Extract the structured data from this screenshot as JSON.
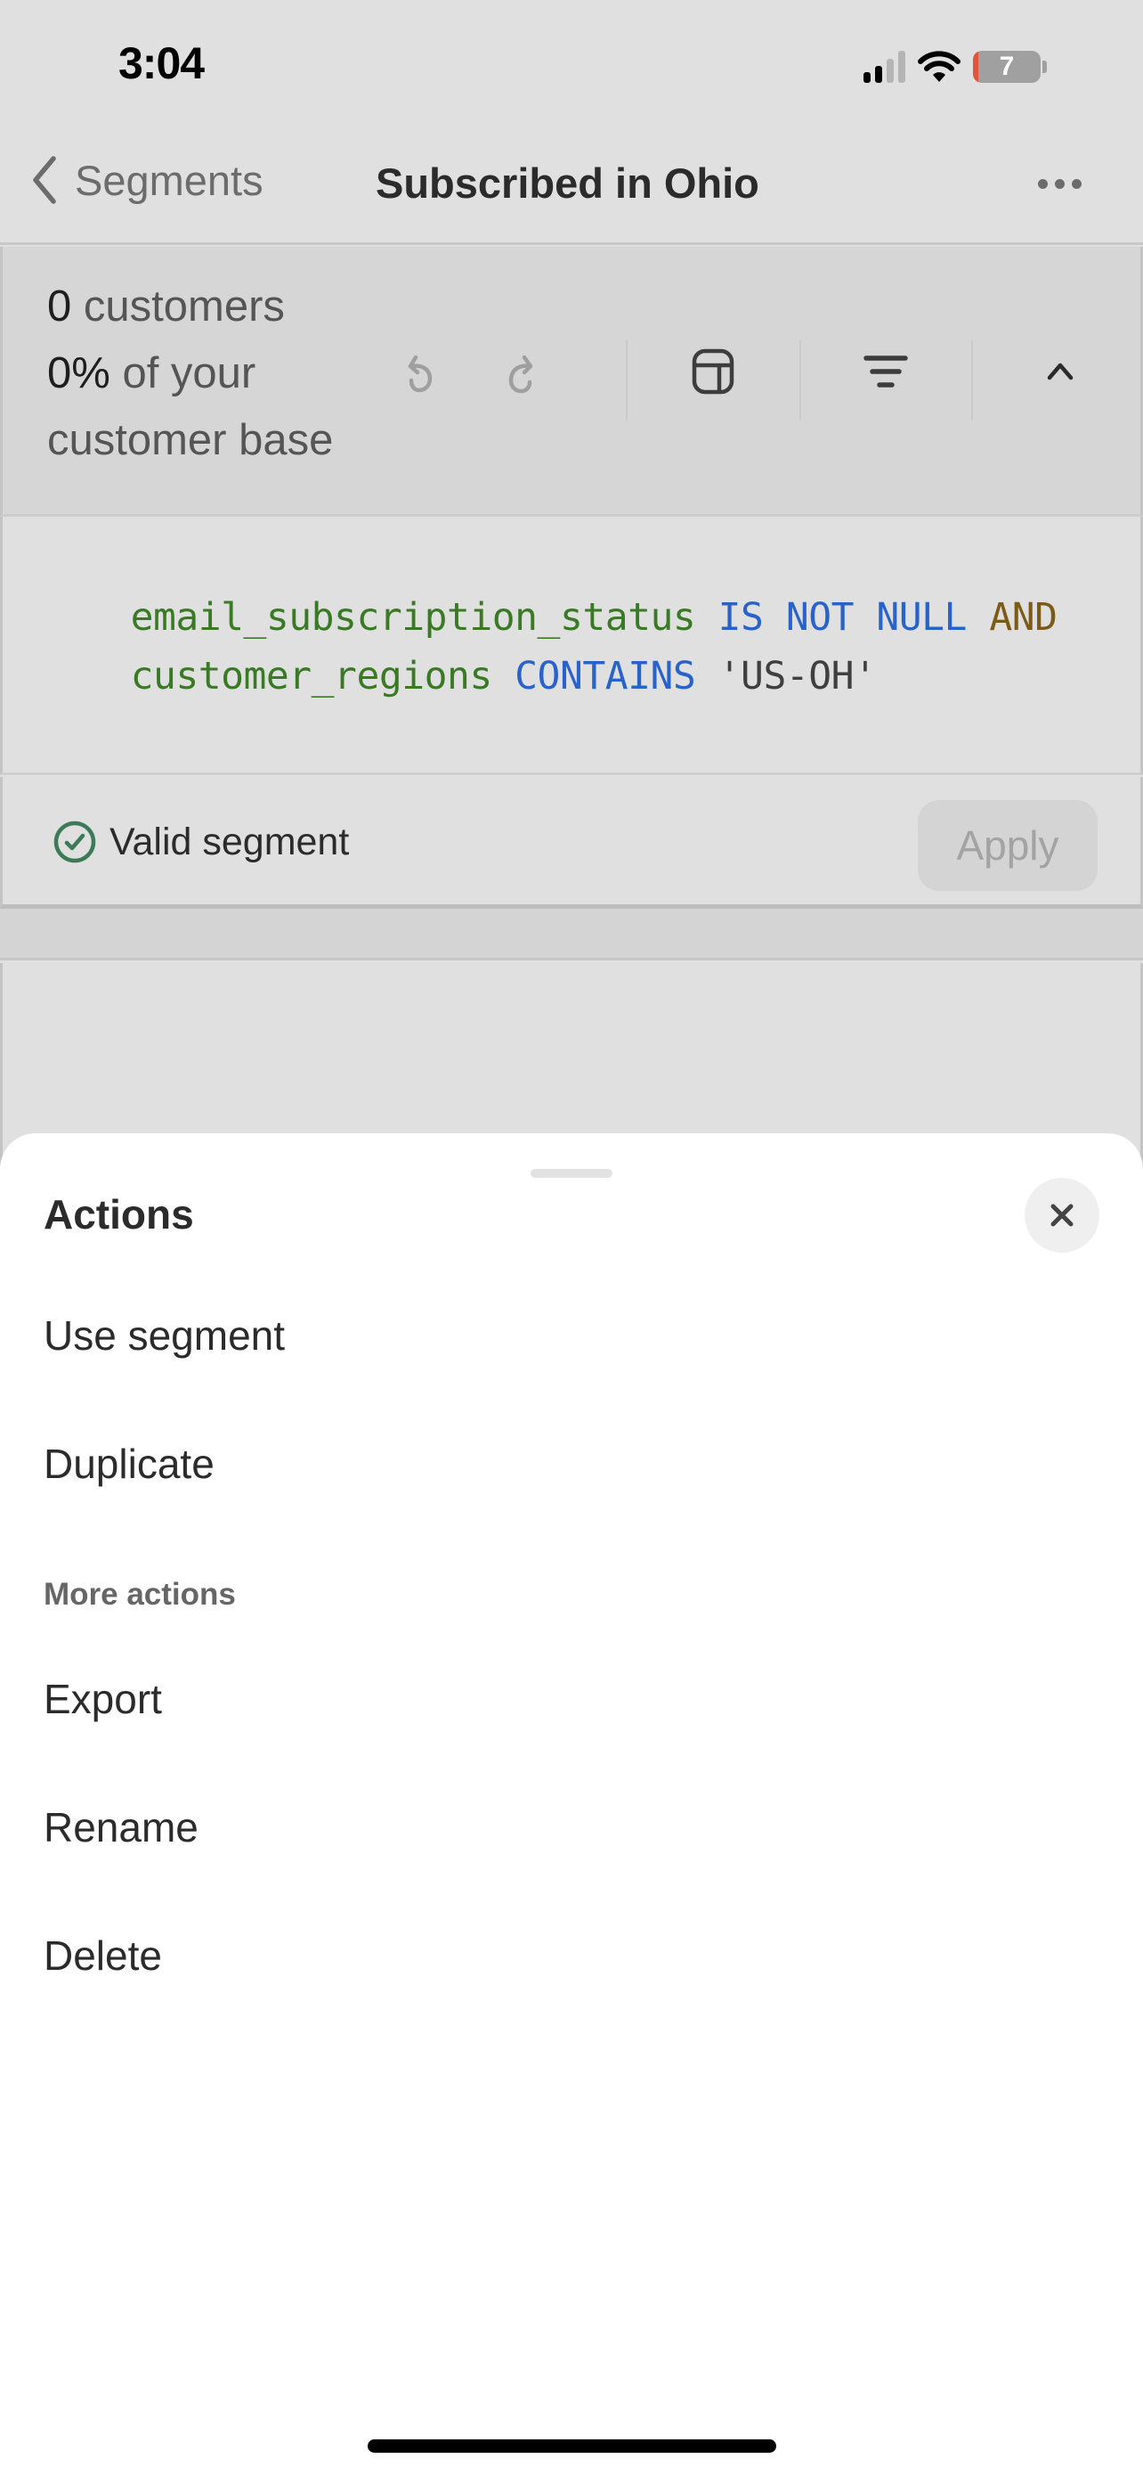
{
  "status_bar": {
    "time": "3:04",
    "signal_bars_active": 2,
    "signal_bars_total": 4,
    "battery_level": "7",
    "icons": [
      "cellular-signal-icon",
      "wifi-icon",
      "battery-icon"
    ]
  },
  "nav": {
    "back_label": "Segments",
    "title": "Subscribed in Ohio",
    "more_icon": "more-horizontal-icon"
  },
  "stats": {
    "count_number": "0",
    "count_label": " customers",
    "percent_number": "0%",
    "percent_label": " of your",
    "percent_label_2": "customer base"
  },
  "toolbar": {
    "items": [
      {
        "icon": "undo-icon",
        "enabled": false
      },
      {
        "icon": "redo-icon",
        "enabled": false
      },
      {
        "icon": "table-layout-icon",
        "enabled": true
      },
      {
        "icon": "filter-icon",
        "enabled": true
      },
      {
        "icon": "chevron-up-icon",
        "enabled": true
      }
    ]
  },
  "query": {
    "line1": [
      {
        "text": "email_subscription_status",
        "type": "field"
      },
      {
        "text": " ",
        "type": "space"
      },
      {
        "text": "IS NOT NULL",
        "type": "keyword"
      },
      {
        "text": " ",
        "type": "space"
      },
      {
        "text": "AND",
        "type": "operator"
      }
    ],
    "line2": [
      {
        "text": "customer_regions",
        "type": "field"
      },
      {
        "text": " ",
        "type": "space"
      },
      {
        "text": "CONTAINS",
        "type": "keyword"
      },
      {
        "text": " ",
        "type": "space"
      },
      {
        "text": "'US-OH'",
        "type": "string"
      }
    ],
    "colors": {
      "field": "#3a7a25",
      "keyword": "#2962c9",
      "operator": "#7c5a18",
      "string": "#3f3f3f"
    }
  },
  "validation": {
    "status_text": "Valid segment",
    "status_color": "#3d7a57",
    "apply_label": "Apply",
    "apply_enabled": false
  },
  "sheet": {
    "title": "Actions",
    "close_icon": "close-icon",
    "primary_actions": [
      {
        "label": "Use segment"
      },
      {
        "label": "Duplicate"
      }
    ],
    "section_label": "More actions",
    "more_actions": [
      {
        "label": "Export"
      },
      {
        "label": "Rename"
      },
      {
        "label": "Delete"
      }
    ]
  }
}
